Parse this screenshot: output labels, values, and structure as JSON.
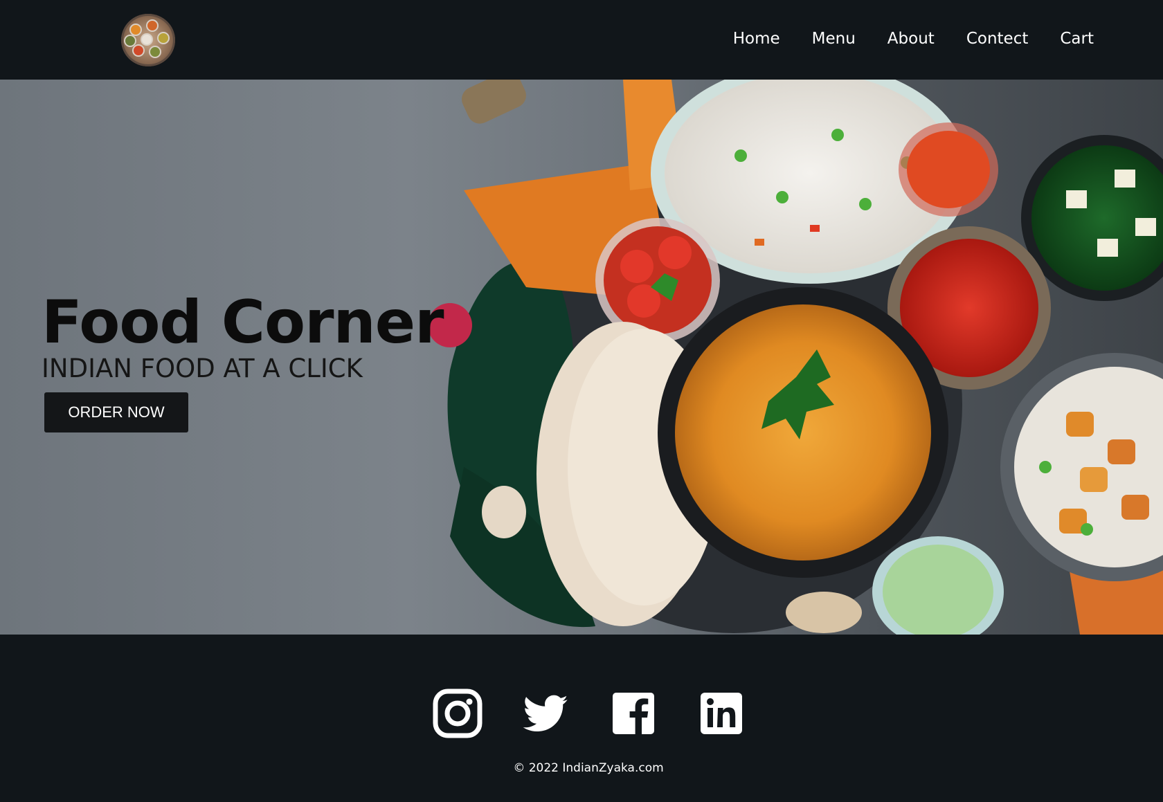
{
  "header": {
    "logo_icon": "food-thali-logo-icon",
    "nav": [
      "Home",
      "Menu",
      "About",
      "Contect",
      "Cart"
    ]
  },
  "hero": {
    "title": "Food Corner",
    "subtitle": "INDIAN FOOD AT A CLICK",
    "cta_label": "ORDER NOW",
    "image_icon": "indian-food-spread-image"
  },
  "footer": {
    "social": [
      "instagram-icon",
      "twitter-icon",
      "facebook-icon",
      "linkedin-icon"
    ],
    "copyright": "© 2022 IndianZyaka.com"
  },
  "colors": {
    "nav_bg": "#11161a",
    "hero_bg": "#7c838a",
    "button_bg": "#141618",
    "text_light": "#ffffff"
  }
}
